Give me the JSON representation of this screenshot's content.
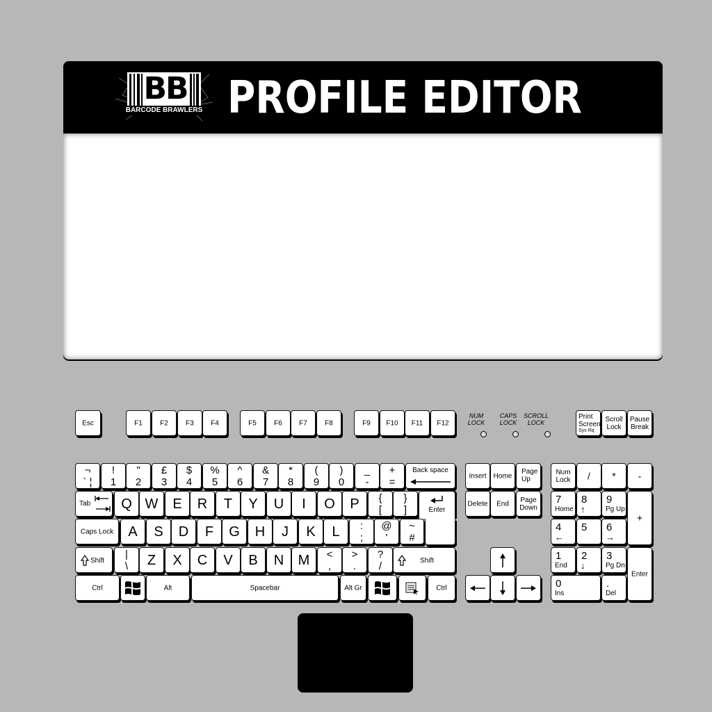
{
  "header": {
    "logo_text": "BB",
    "logo_caption": "BARCODE BRAWLERS",
    "title": "PROFILE EDITOR"
  },
  "indicators": {
    "num_lock": [
      "NUM",
      "LOCK"
    ],
    "caps_lock": [
      "CAPS",
      "LOCK"
    ],
    "scroll_lock": [
      "SCROLL",
      "LOCK"
    ]
  },
  "keys": {
    "esc": "Esc",
    "f": [
      "F1",
      "F2",
      "F3",
      "F4",
      "F5",
      "F6",
      "F7",
      "F8",
      "F9",
      "F10",
      "F11",
      "F12"
    ],
    "print_screen": [
      "Print",
      "Screen",
      "Sys Rq"
    ],
    "scroll_lock": [
      "Scroll",
      "Lock"
    ],
    "pause": [
      "Pause",
      "Break"
    ],
    "number_row": [
      {
        "top": "¬",
        "bot": "` ¦"
      },
      {
        "top": "!",
        "bot": "1"
      },
      {
        "top": "\"",
        "bot": "2"
      },
      {
        "top": "£",
        "bot": "3"
      },
      {
        "top": "$",
        "bot": "4"
      },
      {
        "top": "%",
        "bot": "5"
      },
      {
        "top": "^",
        "bot": "6"
      },
      {
        "top": "&",
        "bot": "7"
      },
      {
        "top": "*",
        "bot": "8"
      },
      {
        "top": "(",
        "bot": "9"
      },
      {
        "top": ")",
        "bot": "0"
      },
      {
        "top": "_",
        "bot": "-"
      },
      {
        "top": "+",
        "bot": "="
      }
    ],
    "backspace": "Back space",
    "tab": "Tab",
    "q_row": [
      "Q",
      "W",
      "E",
      "R",
      "T",
      "Y",
      "U",
      "I",
      "O",
      "P"
    ],
    "bracket_open": {
      "top": "{",
      "bot": "["
    },
    "bracket_close": {
      "top": "}",
      "bot": "]"
    },
    "enter": "Enter",
    "caps_lock": "Caps Lock",
    "a_row": [
      "A",
      "S",
      "D",
      "F",
      "G",
      "H",
      "J",
      "K",
      "L"
    ],
    "semicolon": {
      "top": ":",
      "bot": ";"
    },
    "at": {
      "top": "@",
      "bot": "'"
    },
    "hash": {
      "top": "~",
      "bot": "#"
    },
    "shift": "Shift",
    "backslash": {
      "top": "|",
      "bot": "\\"
    },
    "z_row": [
      "Z",
      "X",
      "C",
      "V",
      "B",
      "N",
      "M"
    ],
    "comma": {
      "top": "<",
      "bot": ","
    },
    "period": {
      "top": ">",
      "bot": "."
    },
    "slash": {
      "top": "?",
      "bot": "/"
    },
    "ctrl": "Ctrl",
    "alt": "Alt",
    "spacebar": "Spacebar",
    "alt_gr": "Alt Gr",
    "insert": "Insert",
    "home": "Home",
    "page_up": [
      "Page",
      "Up"
    ],
    "delete": "Delete",
    "end": "End",
    "page_down": [
      "Page",
      "Down"
    ],
    "num_lock": [
      "Num",
      "Lock"
    ],
    "np_divide": "/",
    "np_multiply": "*",
    "np_minus": "-",
    "np_plus": "+",
    "np_enter": "Enter",
    "np": [
      {
        "n": "7",
        "s": "Home"
      },
      {
        "n": "8",
        "s": "↑"
      },
      {
        "n": "9",
        "s": "Pg Up"
      },
      {
        "n": "4",
        "s": "←"
      },
      {
        "n": "5",
        "s": ""
      },
      {
        "n": "6",
        "s": "→"
      },
      {
        "n": "1",
        "s": "End"
      },
      {
        "n": "2",
        "s": "↓"
      },
      {
        "n": "3",
        "s": "Pg Dn"
      },
      {
        "n": "0",
        "s": "Ins"
      },
      {
        "n": ".",
        "s": "Del"
      }
    ]
  }
}
